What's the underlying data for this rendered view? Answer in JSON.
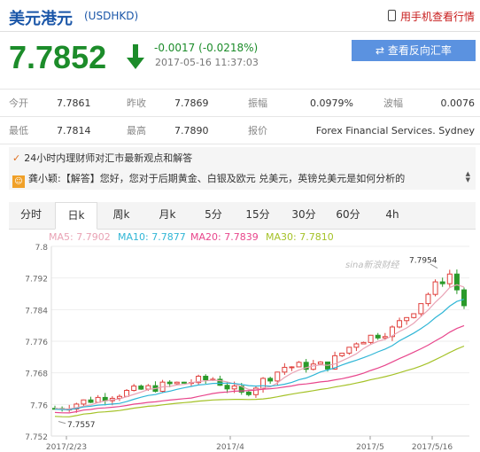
{
  "header": {
    "title": "美元港元",
    "code": "(USDHKD)",
    "mobile_link": "用手机查看行情"
  },
  "quote": {
    "price": "7.7852",
    "change": "-0.0017 (-0.0218%)",
    "time": "2017-05-16 11:37:03",
    "reverse_button": "查看反向汇率",
    "colors": {
      "down": "#1c8c2a",
      "button": "#5b92e0"
    }
  },
  "stats": {
    "row1": [
      {
        "label": "今开",
        "value": "7.7861"
      },
      {
        "label": "昨收",
        "value": "7.7869"
      },
      {
        "label": "振幅",
        "value": "0.0979%"
      },
      {
        "label": "波幅",
        "value": "0.0076"
      }
    ],
    "row2": [
      {
        "label": "最低",
        "value": "7.7814"
      },
      {
        "label": "最高",
        "value": "7.7890"
      },
      {
        "label": "报价",
        "value": "Forex Financial Services. Sydney"
      }
    ]
  },
  "news": {
    "heading": "24小时内理财师对汇市最新观点和解答",
    "item": "龚小颖:【解答】您好，您对于后期黄金、白银及欧元 兑美元，英镑兑美元是如何分析的"
  },
  "tabs": [
    "分时",
    "日k",
    "周k",
    "月k",
    "5分",
    "15分",
    "30分",
    "60分",
    "4h"
  ],
  "active_tab": "日k",
  "chart_data": {
    "type": "candlestick",
    "legend": [
      {
        "name": "MA5: 7.7902",
        "color": "#e9a3b5"
      },
      {
        "name": "MA10: 7.7877",
        "color": "#30b6d6"
      },
      {
        "name": "MA20: 7.7839",
        "color": "#e8468c"
      },
      {
        "name": "MA30: 7.7810",
        "color": "#a5c228"
      }
    ],
    "y_ticks": [
      "7.8",
      "7.792",
      "7.784",
      "7.776",
      "7.768",
      "7.76",
      "7.752"
    ],
    "ylim": [
      7.752,
      7.8
    ],
    "x_ticks": [
      "2017/2/23",
      "2017/4",
      "2017/5",
      "2017/5/16"
    ],
    "annotations": {
      "high": "7.7954",
      "low": "7.7557"
    },
    "watermark": "sina新浪财经",
    "colors": {
      "up": "#e0403c",
      "down": "#2a9a2a"
    }
  }
}
